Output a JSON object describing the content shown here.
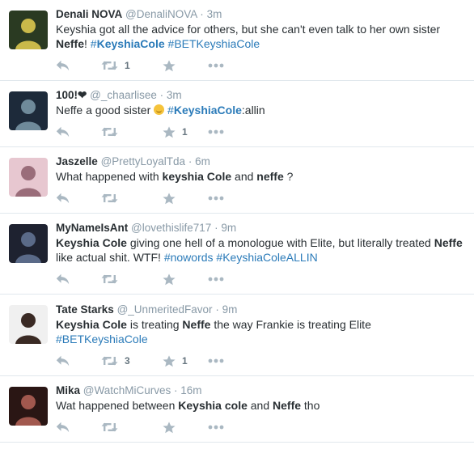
{
  "tweets": [
    {
      "fullname": "Denali NOVA",
      "handle": "@DenaliNOVA",
      "time": "3m",
      "text": [
        {
          "t": "Keyshia got all the advice for others, but she can't even talk to her own sister ",
          "s": "plain"
        },
        {
          "t": "Neffe",
          "s": "bold"
        },
        {
          "t": "! ",
          "s": "plain"
        },
        {
          "t": "#",
          "s": "hash"
        },
        {
          "t": "KeyshiaCole",
          "s": "hashbold"
        },
        {
          "t": " ",
          "s": "plain"
        },
        {
          "t": "#BETKeyshiaCole",
          "s": "hash"
        }
      ],
      "retweets": "1",
      "favorites": "",
      "avatar_colors": [
        "#2a3a22",
        "#c9b94a"
      ]
    },
    {
      "fullname": "100!",
      "heart": "❤",
      "handle": "@_chaarlisee",
      "time": "3m",
      "text": [
        {
          "t": "Neffe a good sister ",
          "s": "plain"
        },
        {
          "t": "",
          "s": "emoji"
        },
        {
          "t": " ",
          "s": "plain"
        },
        {
          "t": "#",
          "s": "hash"
        },
        {
          "t": "KeyshiaCole",
          "s": "hashbold"
        },
        {
          "t": ":allin",
          "s": "plain"
        }
      ],
      "retweets": "",
      "favorites": "1",
      "avatar_colors": [
        "#1d2a3a",
        "#6f8a9a"
      ]
    },
    {
      "fullname": "Jaszelle",
      "handle": "@PrettyLoyalTda",
      "time": "6m",
      "text": [
        {
          "t": "What happened with ",
          "s": "plain"
        },
        {
          "t": "keyshia Cole",
          "s": "bold"
        },
        {
          "t": " and ",
          "s": "plain"
        },
        {
          "t": "neffe",
          "s": "bold"
        },
        {
          "t": " ?",
          "s": "plain"
        }
      ],
      "retweets": "",
      "favorites": "",
      "avatar_colors": [
        "#e7c7d0",
        "#9a6d7a"
      ]
    },
    {
      "fullname": "MyNameIsAnt",
      "handle": "@lovethislife717",
      "time": "9m",
      "text": [
        {
          "t": "Keyshia Cole",
          "s": "bold"
        },
        {
          "t": " giving one hell of a monologue with Elite, but literally treated ",
          "s": "plain"
        },
        {
          "t": "Neffe",
          "s": "bold"
        },
        {
          "t": " like actual shit. WTF! ",
          "s": "plain"
        },
        {
          "t": "#nowords",
          "s": "hash"
        },
        {
          "t": "  ",
          "s": "plain"
        },
        {
          "t": "#KeyshiaColeALLIN",
          "s": "hash"
        }
      ],
      "retweets": "",
      "favorites": "",
      "avatar_colors": [
        "#1e2230",
        "#5a6a88"
      ]
    },
    {
      "fullname": "Tate Starks",
      "handle": "@_UnmeritedFavor",
      "time": "9m",
      "text": [
        {
          "t": "Keyshia Cole",
          "s": "bold"
        },
        {
          "t": " is treating ",
          "s": "plain"
        },
        {
          "t": "Neffe",
          "s": "bold"
        },
        {
          "t": " the way Frankie is treating Elite ",
          "s": "plain"
        },
        {
          "t": "#BETKeyshiaCole",
          "s": "hash"
        }
      ],
      "retweets": "3",
      "favorites": "1",
      "avatar_colors": [
        "#f0f0f0",
        "#3a2a24"
      ]
    },
    {
      "fullname": "Mika",
      "handle": "@WatchMiCurves",
      "time": "16m",
      "text": [
        {
          "t": "Wat happened between ",
          "s": "plain"
        },
        {
          "t": "Keyshia cole",
          "s": "bold"
        },
        {
          "t": " and ",
          "s": "plain"
        },
        {
          "t": "Neffe",
          "s": "bold"
        },
        {
          "t": " tho",
          "s": "plain"
        }
      ],
      "retweets": "",
      "favorites": "",
      "avatar_colors": [
        "#2a1614",
        "#a1584e"
      ]
    }
  ],
  "separator": "·",
  "icons": {
    "reply": "reply-icon",
    "retweet": "retweet-icon",
    "favorite": "star-icon",
    "more": "more-icon"
  },
  "colors": {
    "hashtag": "#2b7bb9",
    "muted": "#8899a6",
    "icon": "#aab8c2"
  }
}
